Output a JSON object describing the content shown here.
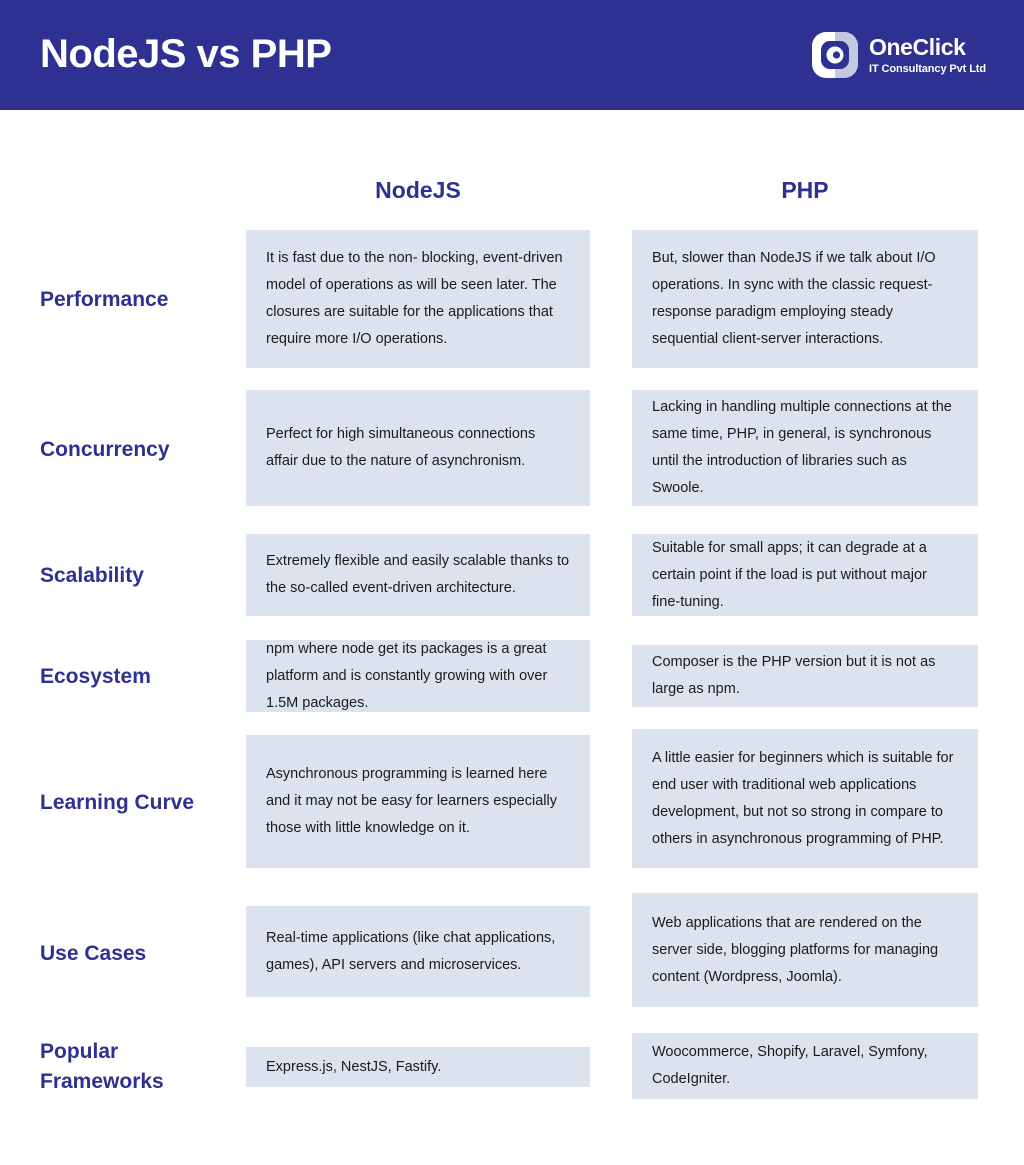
{
  "header": {
    "title": "NodeJS vs PHP",
    "background_color": "#2e3192",
    "logo": {
      "name": "OneClick",
      "tagline": "IT Consultancy Pvt Ltd",
      "mark_glyph": "c"
    }
  },
  "table": {
    "columns": [
      {
        "label": "NodeJS"
      },
      {
        "label": "PHP"
      }
    ],
    "accent_color": "#2e3192",
    "cell_background": "#dce3ef",
    "rows": [
      {
        "label": "Performance",
        "nodejs": "It is fast due to the non- blocking, event-driven model of operations as will be seen later. The closures are suitable for the applications that require more I/O operations.",
        "php": "But, slower than NodeJS if we talk about I/O operations. In sync with the classic request-response paradigm employing steady sequential client-server interactions."
      },
      {
        "label": "Concurrency",
        "nodejs": "Perfect for high simultaneous connections affair due to the nature of asynchronism.",
        "php": "Lacking in handling multiple connections at the same time, PHP, in general, is synchronous until the introduction of libraries such as Swoole."
      },
      {
        "label": "Scalability",
        "nodejs": "Extremely flexible and easily scalable thanks to the so-called event-driven architecture.",
        "php": "Suitable for small apps; it can degrade at a certain point if the load is put without major fine-tuning."
      },
      {
        "label": "Ecosystem",
        "nodejs": "npm where node get its packages is a great platform and is constantly growing with over 1.5M packages.",
        "php": "Composer is the PHP version but it is not as large as npm."
      },
      {
        "label": "Learning Curve",
        "nodejs": "Asynchronous programming is learned here and it may not be easy for learners especially those with little knowledge on it.",
        "php": "A little easier for beginners which is suitable for end user with traditional web applications development, but not so strong in compare to others in asynchronous programming of PHP."
      },
      {
        "label": "Use Cases",
        "nodejs": "Real-time applications (like chat applications, games), API servers and microservices.",
        "php": "Web applications that are rendered on the server side, blogging platforms for managing content (Wordpress, Joomla)."
      },
      {
        "label": "Popular Frameworks",
        "nodejs": "Express.js, NestJS, Fastify.",
        "php": "Woocommerce, Shopify, Laravel, Symfony, CodeIgniter."
      }
    ]
  }
}
